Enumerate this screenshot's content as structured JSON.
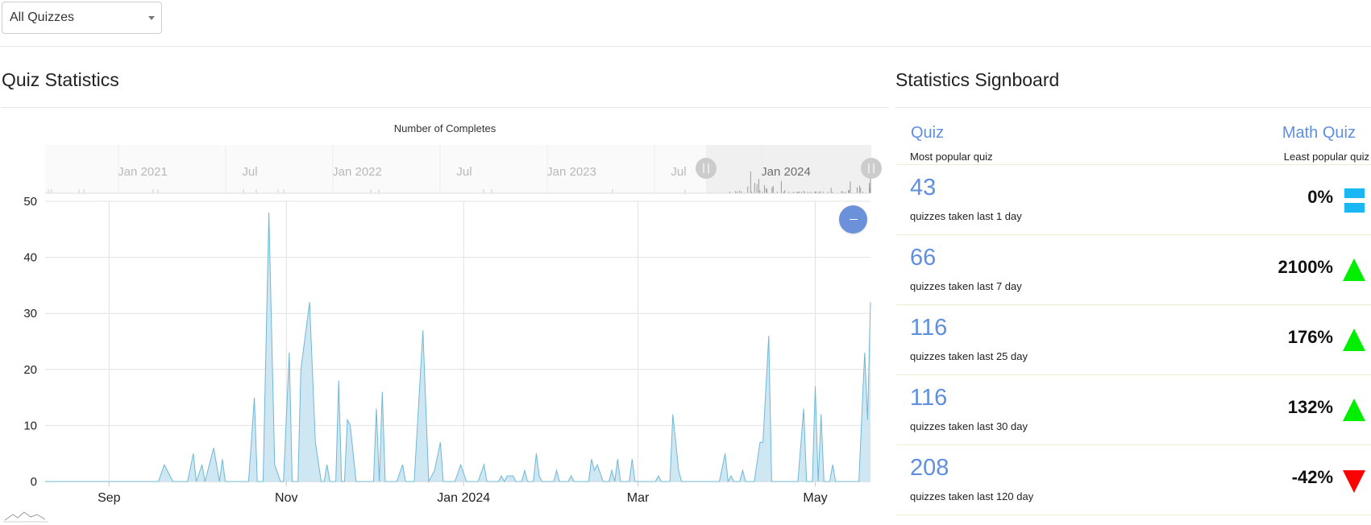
{
  "filter": {
    "selected": "All Quizzes"
  },
  "left_section": {
    "title": "Quiz Statistics"
  },
  "right_section": {
    "title": "Statistics Signboard"
  },
  "chart_data": {
    "type": "area",
    "title": "Number of Completes",
    "ylim": [
      0,
      50
    ],
    "y_ticks": [
      "0",
      "10",
      "20",
      "30",
      "40",
      "50"
    ],
    "x_ticks": [
      "Sep",
      "Nov",
      "Jan 2024",
      "Mar",
      "May"
    ],
    "x_range": [
      "2023-08-10",
      "2024-05-20"
    ],
    "grid": true,
    "series": [
      {
        "points": [
          [
            "2023-08-10",
            0
          ],
          [
            "2023-09-01",
            0
          ],
          [
            "2023-09-18",
            0
          ],
          [
            "2023-09-20",
            3
          ],
          [
            "2023-09-23",
            0
          ],
          [
            "2023-09-28",
            0
          ],
          [
            "2023-09-30",
            5
          ],
          [
            "2023-10-01",
            0
          ],
          [
            "2023-10-03",
            3
          ],
          [
            "2023-10-04",
            0
          ],
          [
            "2023-10-07",
            6
          ],
          [
            "2023-10-09",
            0
          ],
          [
            "2023-10-10",
            4
          ],
          [
            "2023-10-11",
            0
          ],
          [
            "2023-10-19",
            0
          ],
          [
            "2023-10-21",
            15
          ],
          [
            "2023-10-22",
            0
          ],
          [
            "2023-10-24",
            0
          ],
          [
            "2023-10-26",
            48
          ],
          [
            "2023-10-28",
            3
          ],
          [
            "2023-10-30",
            0
          ],
          [
            "2023-10-31",
            0
          ],
          [
            "2023-11-02",
            23
          ],
          [
            "2023-11-03",
            0
          ],
          [
            "2023-11-05",
            0
          ],
          [
            "2023-11-06",
            20
          ],
          [
            "2023-11-09",
            32
          ],
          [
            "2023-11-11",
            7
          ],
          [
            "2023-11-13",
            0
          ],
          [
            "2023-11-14",
            0
          ],
          [
            "2023-11-15",
            3
          ],
          [
            "2023-11-16",
            0
          ],
          [
            "2023-11-18",
            0
          ],
          [
            "2023-11-19",
            18
          ],
          [
            "2023-11-20",
            0
          ],
          [
            "2023-11-21",
            0
          ],
          [
            "2023-11-22",
            11
          ],
          [
            "2023-11-23",
            10
          ],
          [
            "2023-11-25",
            0
          ],
          [
            "2023-12-01",
            0
          ],
          [
            "2023-12-02",
            13
          ],
          [
            "2023-12-03",
            0
          ],
          [
            "2023-12-04",
            16
          ],
          [
            "2023-12-05",
            0
          ],
          [
            "2023-12-09",
            0
          ],
          [
            "2023-12-11",
            3
          ],
          [
            "2023-12-12",
            0
          ],
          [
            "2023-12-15",
            0
          ],
          [
            "2023-12-18",
            27
          ],
          [
            "2023-12-20",
            0
          ],
          [
            "2023-12-22",
            2
          ],
          [
            "2023-12-24",
            7
          ],
          [
            "2023-12-25",
            0
          ],
          [
            "2023-12-29",
            0
          ],
          [
            "2023-12-31",
            3
          ],
          [
            "2024-01-02",
            0
          ],
          [
            "2024-01-06",
            0
          ],
          [
            "2024-01-08",
            3
          ],
          [
            "2024-01-09",
            0
          ],
          [
            "2024-01-13",
            0
          ],
          [
            "2024-01-14",
            1
          ],
          [
            "2024-01-15",
            0
          ],
          [
            "2024-01-16",
            1
          ],
          [
            "2024-01-18",
            1
          ],
          [
            "2024-01-19",
            0
          ],
          [
            "2024-01-21",
            0
          ],
          [
            "2024-01-22",
            2
          ],
          [
            "2024-01-23",
            0
          ],
          [
            "2024-01-25",
            0
          ],
          [
            "2024-01-26",
            5
          ],
          [
            "2024-01-27",
            1
          ],
          [
            "2024-01-28",
            0
          ],
          [
            "2024-02-01",
            0
          ],
          [
            "2024-02-02",
            2
          ],
          [
            "2024-02-03",
            0
          ],
          [
            "2024-02-06",
            0
          ],
          [
            "2024-02-07",
            1
          ],
          [
            "2024-02-08",
            0
          ],
          [
            "2024-02-13",
            0
          ],
          [
            "2024-02-14",
            4
          ],
          [
            "2024-02-15",
            2
          ],
          [
            "2024-02-16",
            3
          ],
          [
            "2024-02-18",
            0
          ],
          [
            "2024-02-20",
            0
          ],
          [
            "2024-02-21",
            2
          ],
          [
            "2024-02-22",
            0
          ],
          [
            "2024-02-23",
            4
          ],
          [
            "2024-02-24",
            0
          ],
          [
            "2024-02-27",
            0
          ],
          [
            "2024-02-28",
            4
          ],
          [
            "2024-02-29",
            0
          ],
          [
            "2024-03-07",
            0
          ],
          [
            "2024-03-08",
            1
          ],
          [
            "2024-03-09",
            0
          ],
          [
            "2024-03-12",
            0
          ],
          [
            "2024-03-13",
            12
          ],
          [
            "2024-03-15",
            2
          ],
          [
            "2024-03-16",
            0
          ],
          [
            "2024-03-29",
            0
          ],
          [
            "2024-03-31",
            5
          ],
          [
            "2024-04-01",
            0
          ],
          [
            "2024-04-02",
            1
          ],
          [
            "2024-04-03",
            0
          ],
          [
            "2024-04-05",
            0
          ],
          [
            "2024-04-06",
            2
          ],
          [
            "2024-04-07",
            0
          ],
          [
            "2024-04-10",
            0
          ],
          [
            "2024-04-12",
            7
          ],
          [
            "2024-04-13",
            7
          ],
          [
            "2024-04-15",
            26
          ],
          [
            "2024-04-16",
            0
          ],
          [
            "2024-04-25",
            0
          ],
          [
            "2024-04-27",
            13
          ],
          [
            "2024-04-28",
            0
          ],
          [
            "2024-04-30",
            0
          ],
          [
            "2024-05-01",
            17
          ],
          [
            "2024-05-02",
            0
          ],
          [
            "2024-05-03",
            12
          ],
          [
            "2024-05-04",
            0
          ],
          [
            "2024-05-06",
            0
          ],
          [
            "2024-05-07",
            3
          ],
          [
            "2024-05-08",
            0
          ],
          [
            "2024-05-16",
            0
          ],
          [
            "2024-05-18",
            23
          ],
          [
            "2024-05-19",
            11
          ],
          [
            "2024-05-20",
            32
          ]
        ]
      }
    ],
    "navigator": {
      "labels": [
        "Jan 2021",
        "Jul",
        "Jan 2022",
        "Jul",
        "Jan 2023",
        "Jul",
        "Jan 2024"
      ],
      "selected_label": "Jan 2024"
    }
  },
  "signboard": {
    "header": {
      "left_name": "Quiz",
      "left_caption": "Most popular quiz",
      "right_name": "Math Quiz",
      "right_caption": "Least popular quiz"
    },
    "rows": [
      {
        "count": "43",
        "caption": "quizzes taken last 1 day",
        "change": "0%",
        "trend": "equal"
      },
      {
        "count": "66",
        "caption": "quizzes taken last 7 day",
        "change": "2100%",
        "trend": "up"
      },
      {
        "count": "116",
        "caption": "quizzes taken last 25 day",
        "change": "176%",
        "trend": "up"
      },
      {
        "count": "116",
        "caption": "quizzes taken last 30 day",
        "change": "132%",
        "trend": "up"
      },
      {
        "count": "208",
        "caption": "quizzes taken last 120 day",
        "change": "-42%",
        "trend": "down"
      }
    ],
    "colors": {
      "up": "#00ee00",
      "down": "#ff0000",
      "equal": "#1ab7f5",
      "accent": "#5f8fe0"
    }
  }
}
